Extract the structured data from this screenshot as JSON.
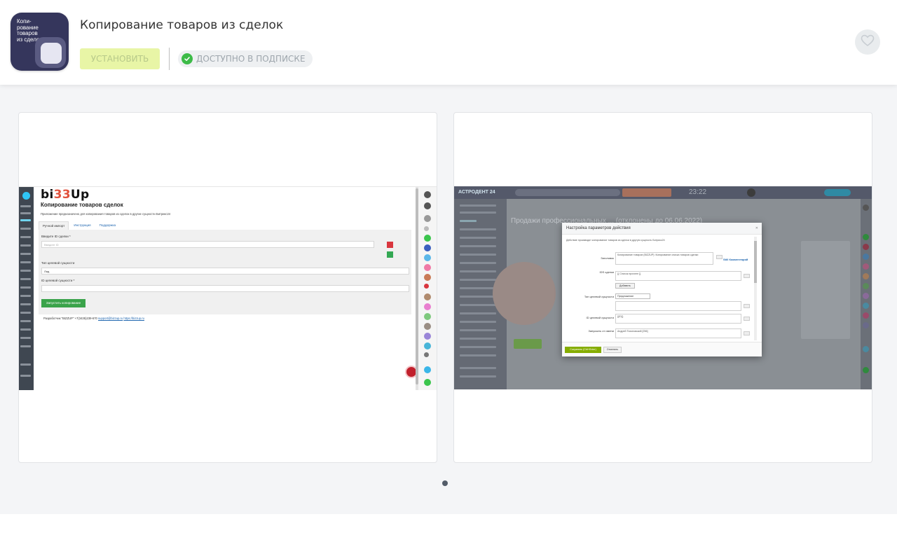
{
  "app": {
    "icon_text": "Копи-\nрование\nтоваров\nиз сделок",
    "title": "Копирование товаров из сделок",
    "install_label": "УСТАНОВИТЬ",
    "subscription_label": "ДОСТУПНО В ПОДПИСКЕ"
  },
  "colors": {
    "install_bg": "#e8f5a6",
    "check_green": "#3dbb48",
    "icon_bg": "#35365c",
    "gallery_bg": "#f4f5f7"
  },
  "icons": {
    "favorite": "heart-icon",
    "subscription": "check-circle-icon"
  },
  "gallery": {
    "slides": [
      {
        "logo_part1": "bi",
        "logo_part2": "33",
        "logo_part3": "Up",
        "title": "Копирование товаров сделок",
        "description": "Приложение предназначено для копирования товаров из сделок в другие сущности Битрикс24",
        "tabs": [
          "Ручной импорт",
          "Инструкция",
          "Поддержка"
        ],
        "deal_id_label": "Введите ID сделки *",
        "deal_id_placeholder": "Введите ID",
        "entity_type_label": "Тип целевой сущности",
        "entity_type_value": "Лид",
        "entity_id_label": "ID целевой сущности *",
        "run_button": "Запустить копирование",
        "footer_text": "Разработчик \"BIZZUP\" +7(3435)239-670",
        "footer_email": "support@bizzup.ru",
        "footer_site": "https://bizzup.ru"
      },
      {
        "top_logo": "АСТРОДЕНТ 24",
        "clock": "23:22",
        "bg_title": "Продажи профессиональных ... (отклонены до 06.06.2022)",
        "modal_title": "Настройка параметров действия",
        "modal_desc": "Действие производит копирование товаров из сделки в другую сущность Битрикс24",
        "row_header_label": "Заголовок",
        "row_header_value": "Копирование товаров (BIZZUP): Копирование списка товаров сделки",
        "link_label": "Still Комментарий",
        "row_ids_label": "IDS сделки",
        "row_ids_value": "{{ Список прочнее }}",
        "add_button": "Добавить",
        "row_type_label": "Тип целевой сущности",
        "row_type_value": "Предложение",
        "row_target_label": "ID целевой сущности",
        "row_target_value": "{{ID}}",
        "row_run_label": "Запускать от имени",
        "row_run_value": "Андрей Тихоновский [256]",
        "save_button": "Сохранить (Ctrl+Enter)",
        "cancel_button": "Отменить"
      }
    ],
    "active_slide": 1
  }
}
